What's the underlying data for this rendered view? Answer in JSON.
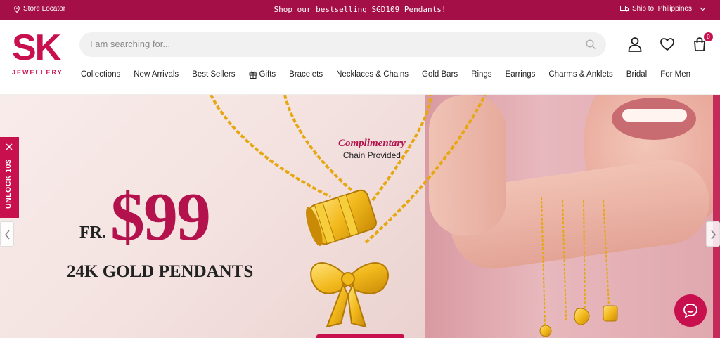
{
  "topbar": {
    "store_locator": "Store Locator",
    "promo": "Shop our bestselling SGD109 Pendants!",
    "ship_to": "Ship to: Philippines"
  },
  "logo": {
    "brand": "SK",
    "sub": "JEWELLERY"
  },
  "search": {
    "placeholder": "I am searching for..."
  },
  "cart": {
    "count": "0"
  },
  "nav": {
    "items": [
      {
        "label": "Collections"
      },
      {
        "label": "New Arrivals"
      },
      {
        "label": "Best Sellers"
      },
      {
        "label": "Gifts"
      },
      {
        "label": "Bracelets"
      },
      {
        "label": "Necklaces & Chains"
      },
      {
        "label": "Gold Bars"
      },
      {
        "label": "Rings"
      },
      {
        "label": "Earrings"
      },
      {
        "label": "Charms & Anklets"
      },
      {
        "label": "Bridal"
      },
      {
        "label": "For Men"
      }
    ]
  },
  "hero": {
    "complimentary": "Complimentary",
    "chain": "Chain Provided",
    "fr": "FR.",
    "price": "$99",
    "subtitle": "24K GOLD PENDANTS"
  },
  "unlock": {
    "label": "UNLOCK 10$"
  },
  "colors": {
    "brand": "#c8104e",
    "topbar": "#a50f47"
  }
}
